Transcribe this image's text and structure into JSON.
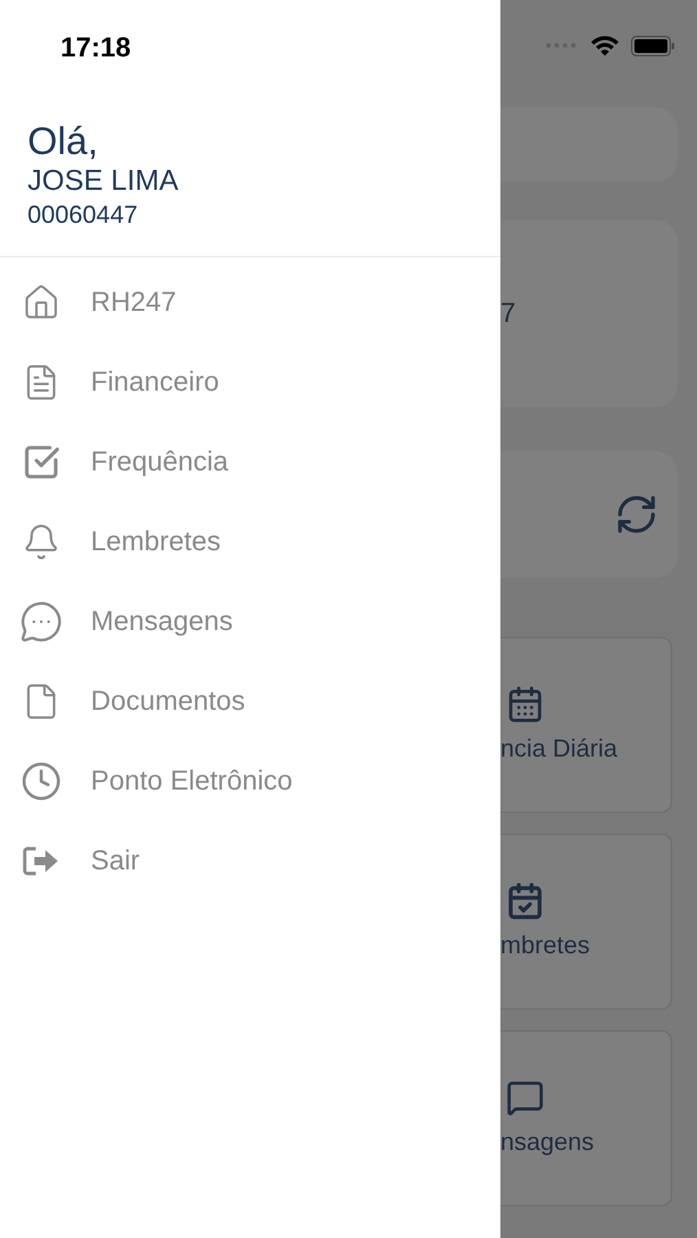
{
  "status_bar": {
    "time": "17:18"
  },
  "drawer": {
    "greeting": "Olá,",
    "user_name": "JOSE LIMA",
    "user_id": "00060447",
    "menu": [
      {
        "label": "RH247"
      },
      {
        "label": "Financeiro"
      },
      {
        "label": "Frequência"
      },
      {
        "label": "Lembretes"
      },
      {
        "label": "Mensagens"
      },
      {
        "label": "Documentos"
      },
      {
        "label": "Ponto Eletrônico"
      },
      {
        "label": "Sair"
      }
    ]
  },
  "background": {
    "card_text": "7",
    "tiles": [
      {
        "label": "ncia Diária"
      },
      {
        "label": "mbretes"
      },
      {
        "label": "nsagens"
      }
    ]
  }
}
